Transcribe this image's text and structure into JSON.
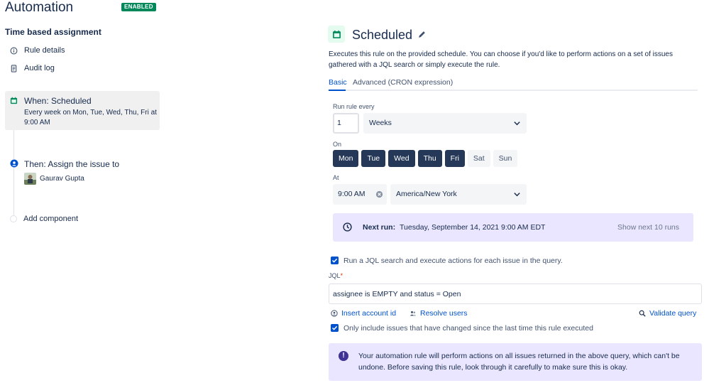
{
  "app": {
    "title": "Automation",
    "status_badge": "ENABLED"
  },
  "rule": {
    "name": "Time based assignment"
  },
  "nav": {
    "rule_details": "Rule details",
    "audit_log": "Audit log"
  },
  "components": {
    "when": {
      "title": "When: Scheduled",
      "description": "Every week on Mon, Tue, Wed, Thu, Fri at 9:00 AM"
    },
    "then": {
      "title": "Then: Assign the issue to",
      "assignee": "Gaurav Gupta"
    },
    "add_label": "Add component"
  },
  "trigger": {
    "title": "Scheduled",
    "description": "Executes this rule on the provided schedule. You can choose if you'd like to perform actions on a set of issues gathered with a JQL search or simply execute the rule.",
    "tabs": [
      {
        "label": "Basic",
        "active": true
      },
      {
        "label": "Advanced (CRON expression)",
        "active": false
      }
    ]
  },
  "schedule": {
    "run_every_label": "Run rule every",
    "interval": "1",
    "unit": "Weeks",
    "on_label": "On",
    "days": [
      {
        "label": "Mon",
        "selected": true
      },
      {
        "label": "Tue",
        "selected": true
      },
      {
        "label": "Wed",
        "selected": true
      },
      {
        "label": "Thu",
        "selected": true
      },
      {
        "label": "Fri",
        "selected": true
      },
      {
        "label": "Sat",
        "selected": false
      },
      {
        "label": "Sun",
        "selected": false
      }
    ],
    "at_label": "At",
    "time": "9:00 AM",
    "timezone": "America/New York"
  },
  "next_run": {
    "label": "Next run:",
    "value": "Tuesday, September 14, 2021 9:00 AM EDT",
    "show_more": "Show next 10 runs"
  },
  "jql": {
    "run_search_label": "Run a JQL search and execute actions for each issue in the query.",
    "run_search_checked": true,
    "label": "JQL",
    "required_mark": "*",
    "query": "assignee is EMPTY and status = Open",
    "insert_account_id": "Insert account id",
    "resolve_users": "Resolve users",
    "validate_query": "Validate query",
    "only_changed_label": "Only include issues that have changed since the last time this rule executed",
    "only_changed_checked": true
  },
  "warning": {
    "text": "Your automation rule will perform actions on all issues returned in the above query, which can't be undone. Before saving this rule, look through it carefully to make sure this is okay."
  },
  "colors": {
    "enabled_green": "#00875a",
    "day_selected": "#253858",
    "info_panel": "#eae6ff",
    "link_blue": "#0052cc",
    "warning_icon": "#403294"
  }
}
